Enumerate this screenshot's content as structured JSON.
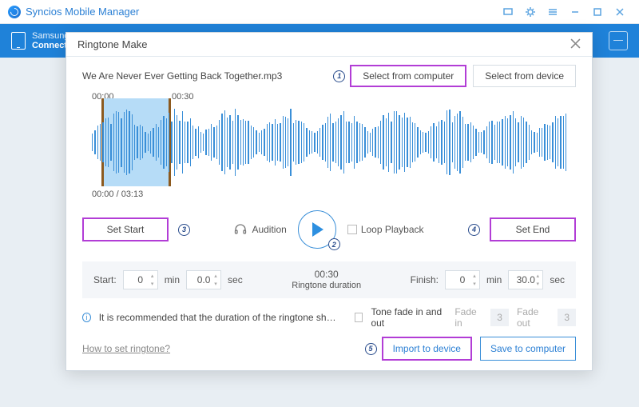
{
  "app": {
    "title": "Syncios Mobile Manager"
  },
  "device": {
    "name": "Samsung",
    "status": "Connect"
  },
  "modal": {
    "title": "Ringtone Make",
    "filename": "We Are Never Ever Getting Back Together.mp3",
    "buttons": {
      "select_computer": "Select from computer",
      "select_device": "Select from device",
      "set_start": "Set Start",
      "set_end": "Set End",
      "audition": "Audition",
      "loop": "Loop Playback",
      "import": "Import to device",
      "save": "Save to computer"
    },
    "times": {
      "sel_start_label": "00:00",
      "sel_end_label": "00:30",
      "position": "00:00 / 03:13"
    },
    "range": {
      "start_label": "Start:",
      "start_min": "0",
      "start_sec": "0.0",
      "min_unit": "min",
      "sec_unit": "sec",
      "duration_value": "00:30",
      "duration_label": "Ringtone duration",
      "finish_label": "Finish:",
      "finish_min": "0",
      "finish_sec": "30.0"
    },
    "fade": {
      "tip": "It is recommended that the duration of the ringtone shou...",
      "tone_label": "Tone fade in and out",
      "fade_in_label": "Fade in",
      "fade_in_val": "3",
      "fade_out_label": "Fade out",
      "fade_out_val": "3"
    },
    "footer": {
      "howto": "How to set ringtone?"
    },
    "steps": {
      "s1": "1",
      "s2": "2",
      "s3": "3",
      "s4": "4",
      "s5": "5"
    }
  }
}
